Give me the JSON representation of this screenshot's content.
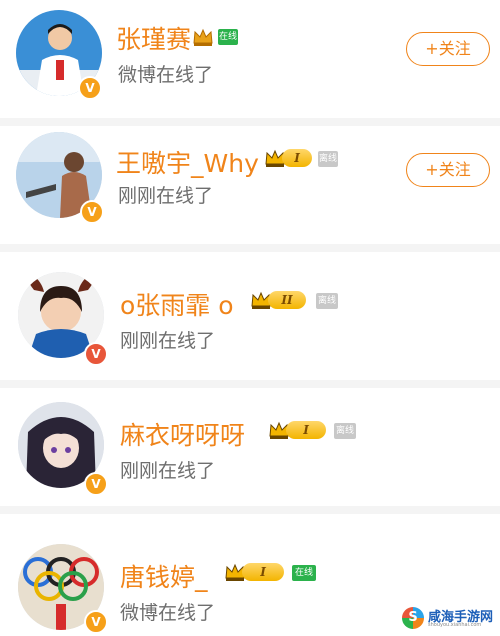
{
  "users": [
    {
      "name": "张瑾赛",
      "status": "微博在线了",
      "tag": "在线",
      "follow": "+关注",
      "badge": "V"
    },
    {
      "name": "王嗷宇_Why",
      "status": "刚刚在线了",
      "level": "I",
      "tag": "离线",
      "follow": "+关注",
      "badge": "V"
    },
    {
      "name": "o张雨霏 o",
      "status": "刚刚在线了",
      "level": "II",
      "tag": "离线",
      "badge": "V"
    },
    {
      "name": "麻衣呀呀呀",
      "status": "刚刚在线了",
      "level": "I",
      "tag": "离线",
      "badge": "V"
    },
    {
      "name": "唐钱婷_",
      "status": "微博在线了",
      "level": "I",
      "tag": "在线",
      "badge": "V"
    }
  ],
  "watermark": {
    "title": "咸海手游网",
    "subtitle": "shouyou.xianhai.com"
  },
  "colors": {
    "name": "#f0841a",
    "status": "#6e6e6e",
    "vip_gold": "#f3b400",
    "online_green": "#2bb24c",
    "offline_gray": "#c8c8c8"
  }
}
